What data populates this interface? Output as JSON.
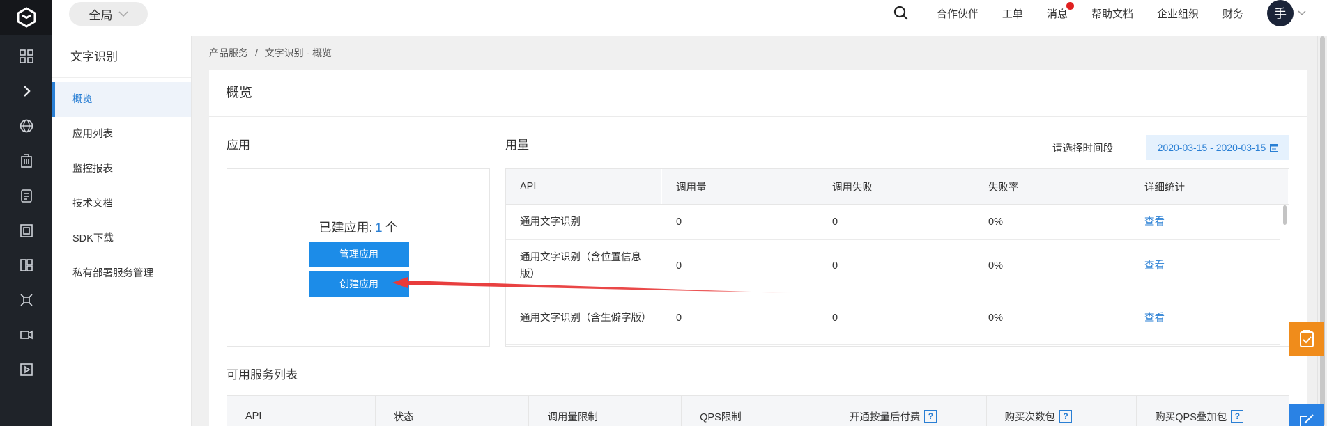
{
  "topbar": {
    "scope_label": "全局",
    "links": [
      "合作伙伴",
      "工单",
      "消息",
      "帮助文档",
      "企业组织",
      "财务"
    ],
    "avatar_char": "手"
  },
  "sidebar": {
    "title": "文字识别",
    "items": [
      {
        "label": "概览",
        "active": true
      },
      {
        "label": "应用列表"
      },
      {
        "label": "监控报表"
      },
      {
        "label": "技术文档"
      },
      {
        "label": "SDK下载"
      },
      {
        "label": "私有部署服务管理"
      }
    ]
  },
  "breadcrumb": {
    "root": "产品服务",
    "separator": "/",
    "current": "文字识别 - 概览"
  },
  "main": {
    "title": "概览",
    "apps": {
      "section_title": "应用",
      "count_prefix": "已建应用:",
      "count_value": "1",
      "count_suffix": "个",
      "manage_label": "管理应用",
      "create_label": "创建应用"
    },
    "usage": {
      "section_title": "用量",
      "date_label": "请选择时间段",
      "date_range": "2020-03-15 - 2020-03-15",
      "columns": [
        "API",
        "调用量",
        "调用失败",
        "失败率",
        "详细统计"
      ],
      "rows": [
        {
          "api": "通用文字识别",
          "calls": "0",
          "failed": "0",
          "rate": "0%",
          "detail": "查看"
        },
        {
          "api": "通用文字识别（含位置信息版）",
          "calls": "0",
          "failed": "0",
          "rate": "0%",
          "detail": "查看"
        },
        {
          "api": "通用文字识别（含生僻字版）",
          "calls": "0",
          "failed": "0",
          "rate": "0%",
          "detail": "查看"
        }
      ]
    },
    "services": {
      "section_title": "可用服务列表",
      "columns": [
        "API",
        "状态",
        "调用量限制",
        "QPS限制",
        "开通按量后付费",
        "购买次数包",
        "购买QPS叠加包"
      ],
      "help_glyph": "?"
    }
  },
  "colors": {
    "accent": "#2a7fd4",
    "primary_button": "#1c8ce8",
    "rail_bg": "#1f2329",
    "annotation_arrow": "#e83a3a",
    "float_orange": "#f08c1b",
    "float_blue": "#2a82e4"
  }
}
